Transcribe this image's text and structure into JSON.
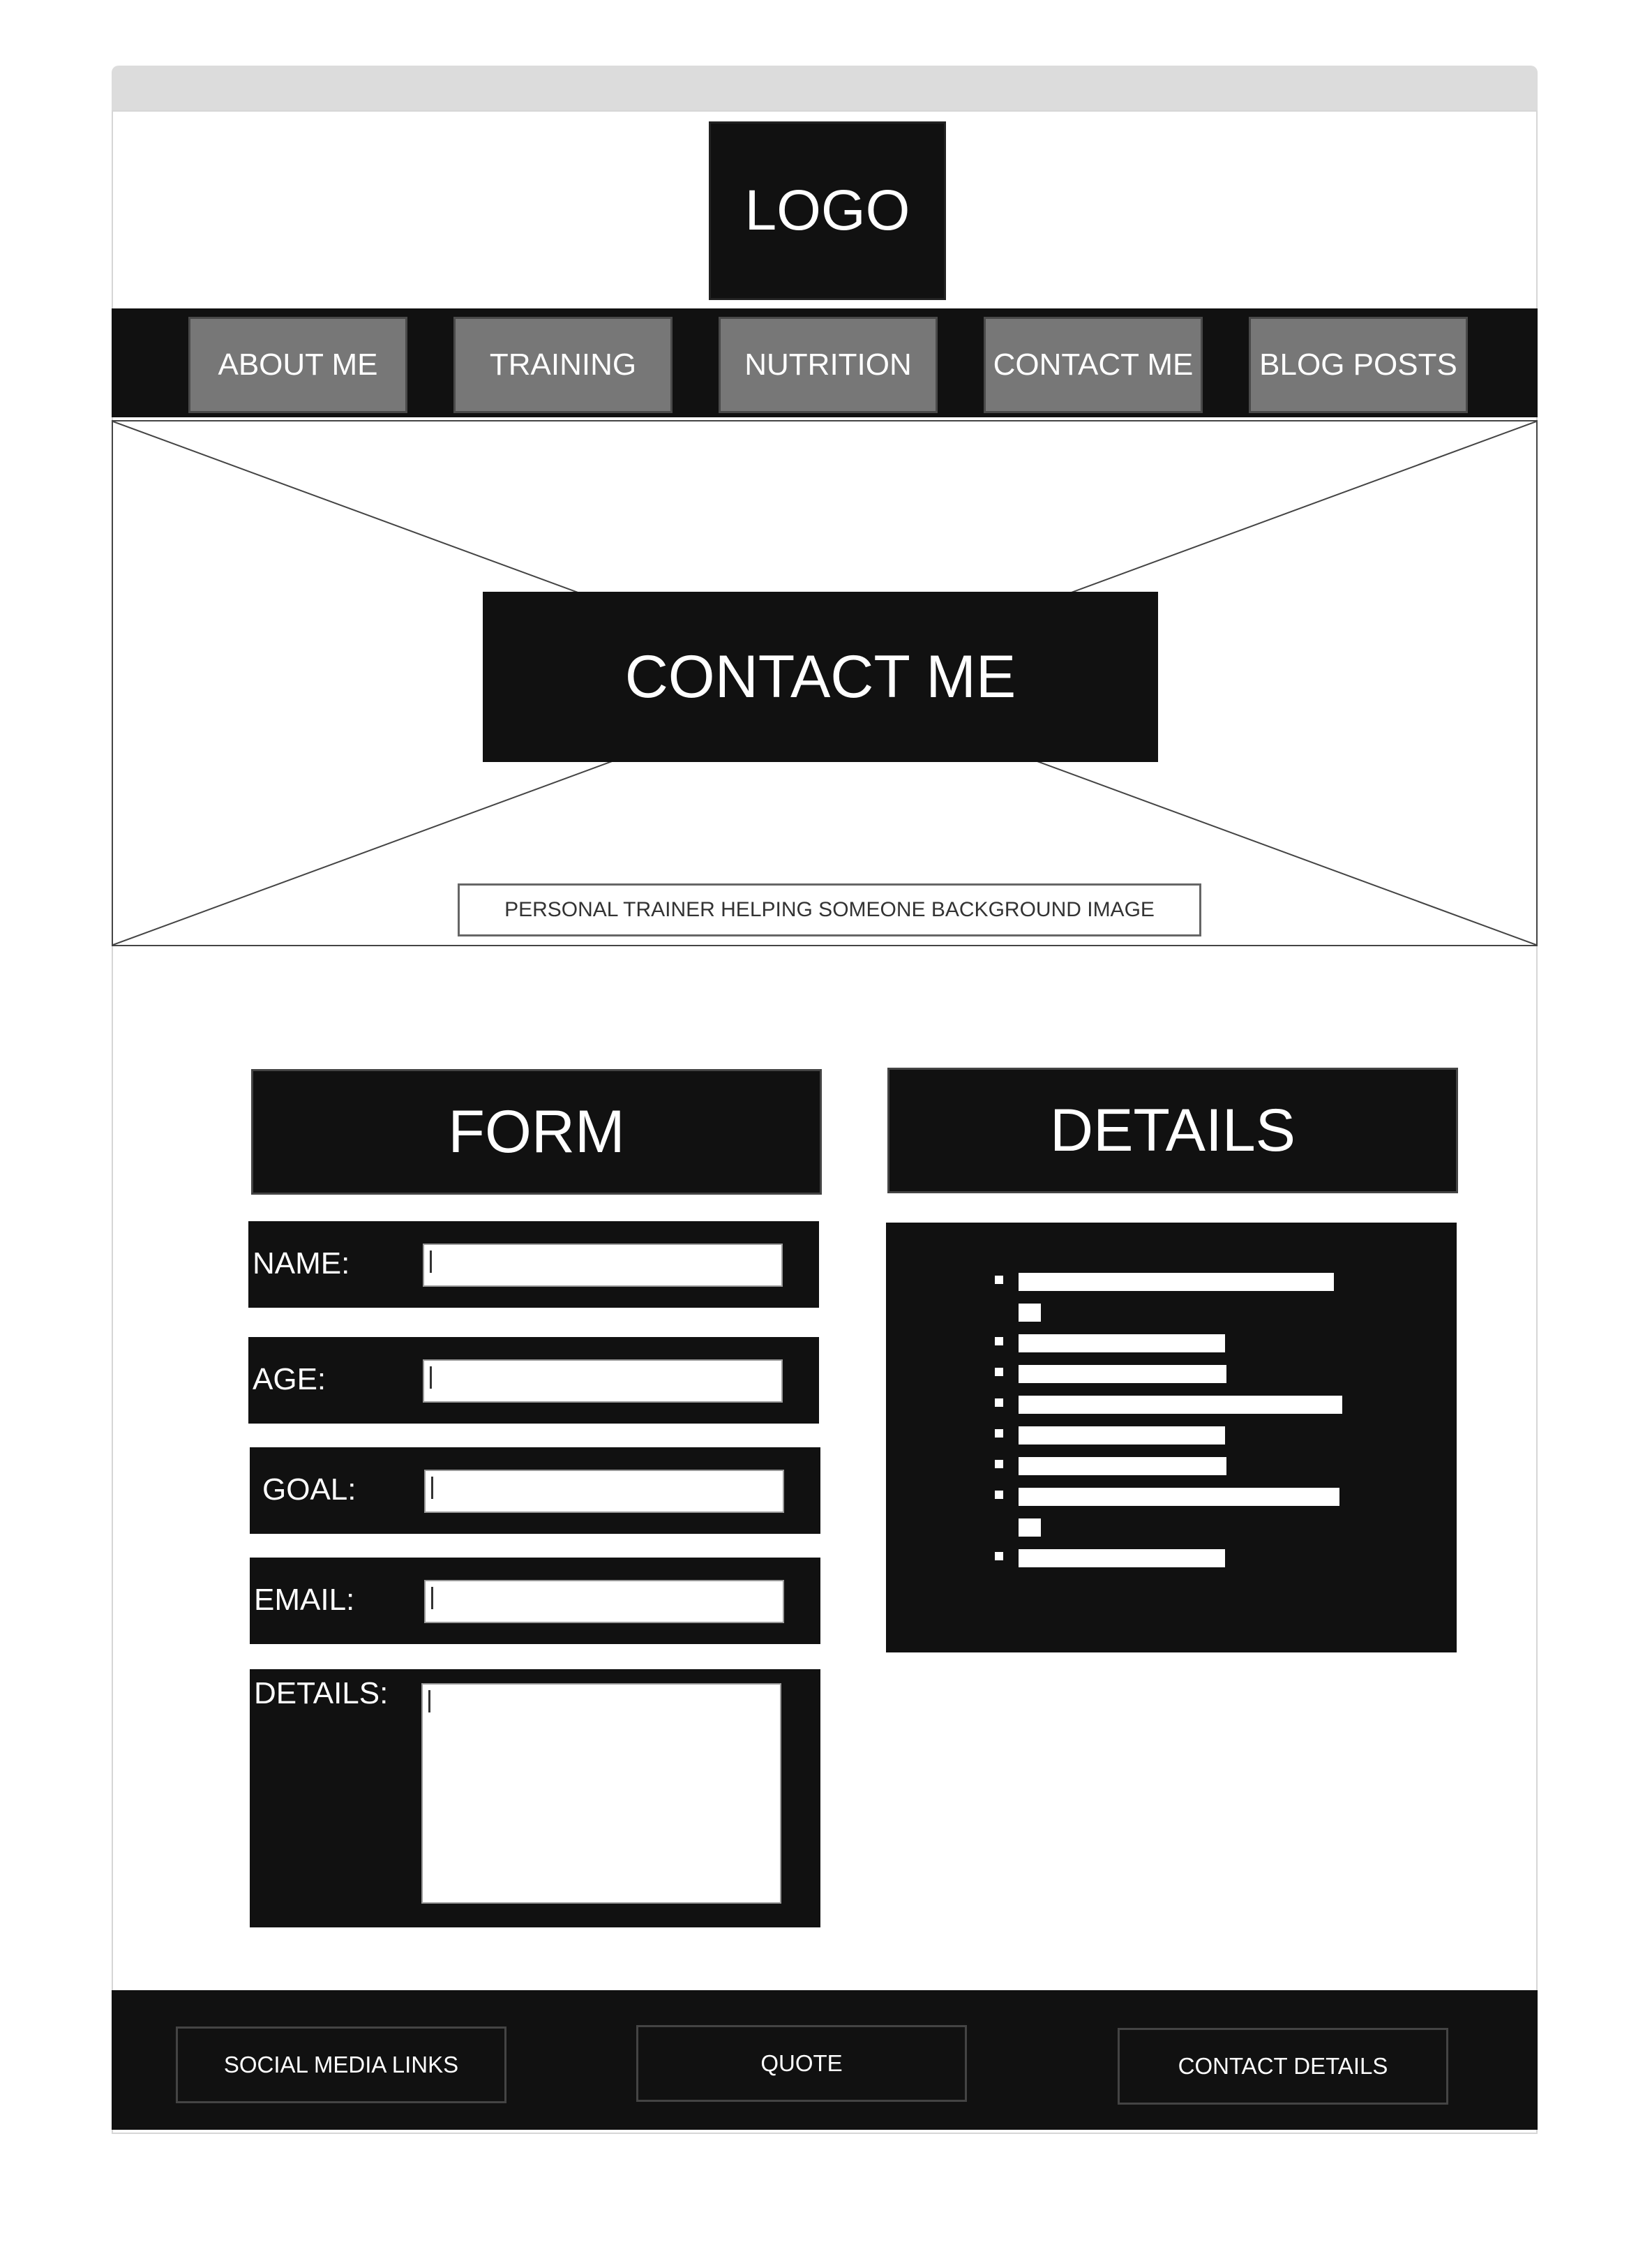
{
  "header": {
    "logo": "LOGO"
  },
  "nav": {
    "items": [
      {
        "label": "ABOUT ME"
      },
      {
        "label": "TRAINING"
      },
      {
        "label": "NUTRITION"
      },
      {
        "label": "CONTACT ME"
      },
      {
        "label": "BLOG POSTS"
      }
    ]
  },
  "hero": {
    "title": "CONTACT ME",
    "caption": "PERSONAL TRAINER HELPING SOMEONE BACKGROUND IMAGE"
  },
  "form": {
    "heading": "FORM",
    "fields": {
      "name": "NAME:",
      "age": "AGE:",
      "goal": "GOAL:",
      "email": "EMAIL:",
      "details": "DETAILS:"
    }
  },
  "details": {
    "heading": "DETAILS"
  },
  "footer": {
    "social": "SOCIAL MEDIA LINKS",
    "quote": "QUOTE",
    "contact": "CONTACT DETAILS"
  },
  "colors": {
    "dark": "#111111",
    "nav_button": "#777777",
    "browser_bar": "#dcdcdc"
  }
}
